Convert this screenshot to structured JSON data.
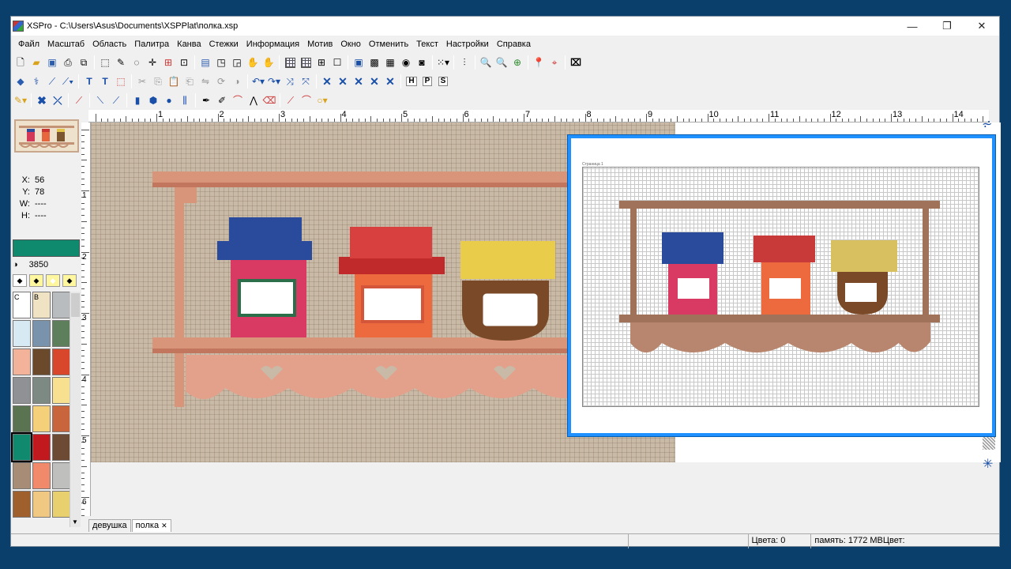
{
  "window": {
    "title": "XSPro - C:\\Users\\Asus\\Documents\\XSPPlat\\полка.xsp",
    "minimize": "—",
    "restore": "❐",
    "close": "✕"
  },
  "menu": [
    "Файл",
    "Масштаб",
    "Область",
    "Палитра",
    "Канва",
    "Стежки",
    "Информация",
    "Мотив",
    "Окно",
    "Отменить",
    "Текст",
    "Настройки",
    "Справка"
  ],
  "toolbar2_labels": {
    "h": "H",
    "p": "P",
    "s": "S"
  },
  "coords": {
    "x_label": "X:",
    "x_value": "56",
    "y_label": "Y:",
    "y_value": "78",
    "w_label": "W:",
    "w_value": "----",
    "h_label": "H:",
    "h_value": "----"
  },
  "current_color": {
    "hex": "#0f8a6e",
    "code": "3850",
    "code_icon": "◑"
  },
  "palette": {
    "labels": [
      "C",
      "B",
      ""
    ],
    "swatches": [
      "#ffffff",
      "#efe3c4",
      "#b9bcbf",
      "#d7e9f3",
      "#7a93ad",
      "#5e7f5c",
      "#f3b39a",
      "#6b4a2c",
      "#d8472c",
      "#8f9194",
      "#7d8a84",
      "#f7e08f",
      "#5a7350",
      "#f4d07a",
      "#c9653d",
      "#0f8a6e",
      "#c2191e",
      "#6d4a33",
      "#a78c76",
      "#f08a6a",
      "#bfc0bd",
      "#a0602e",
      "#f0c882",
      "#e7d06d"
    ]
  },
  "hruler": [
    "1",
    "2",
    "3",
    "4",
    "5",
    "6",
    "7",
    "8",
    "9",
    "10",
    "11",
    "12",
    "13",
    "14"
  ],
  "vruler": [
    "1",
    "2",
    "3",
    "4",
    "5",
    "6"
  ],
  "tabs": [
    "девушка",
    "полка"
  ],
  "status": {
    "colors": "Цвета: 0",
    "memory": "память: 1772 МВ",
    "color_label": "Цвет:"
  },
  "preview": {
    "page_label": "Страница 1"
  }
}
